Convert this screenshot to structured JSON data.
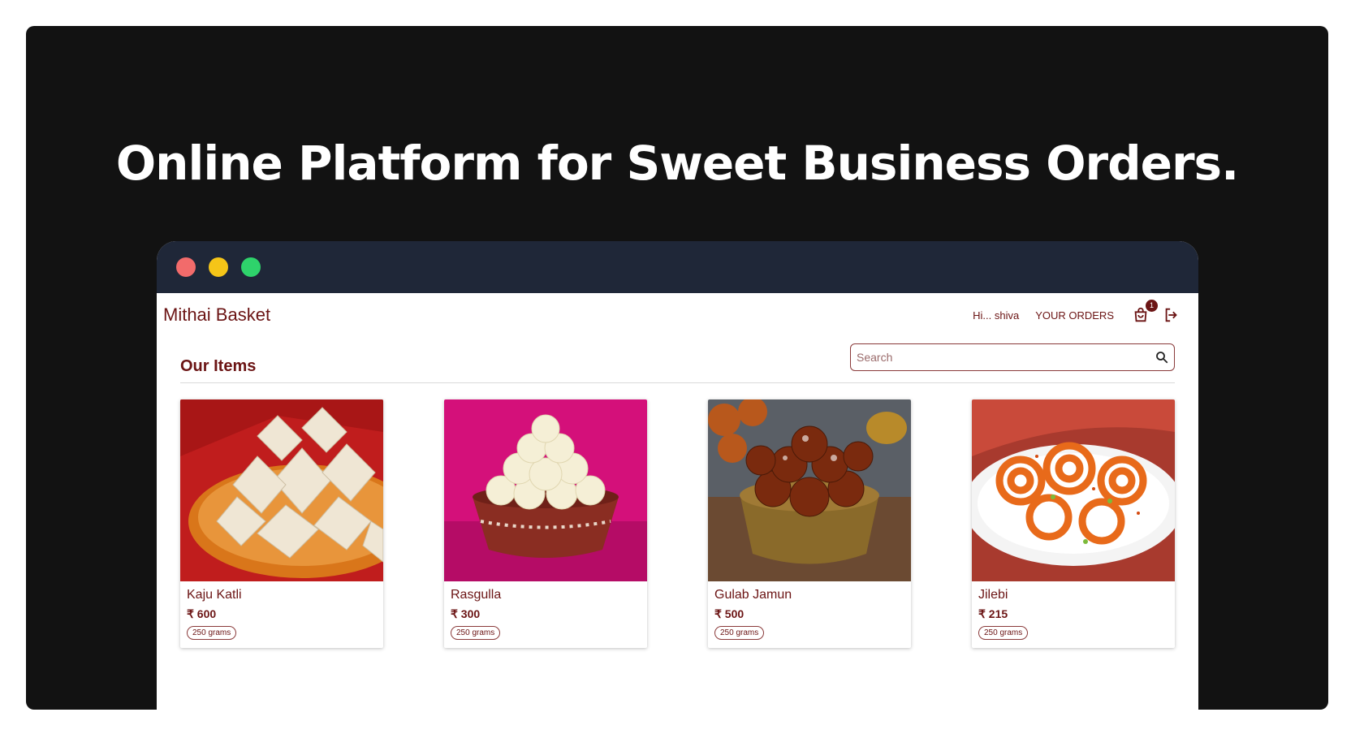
{
  "headline": "Online Platform for Sweet Business Orders.",
  "window_colors": {
    "close": "#f26b6b",
    "minimize": "#f5c518",
    "maximize": "#2ed36b"
  },
  "navbar": {
    "brand": "Mithai Basket",
    "greeting": "Hi... shiva",
    "orders_label": "YOUR ORDERS",
    "cart_count": "1",
    "cart_icon": "shopping-bag-icon",
    "logout_icon": "logout-icon"
  },
  "main": {
    "title": "Our Items",
    "search": {
      "placeholder": "Search",
      "value": "",
      "icon": "search-icon"
    }
  },
  "items": [
    {
      "name": "Kaju Katli",
      "price": "₹ 600",
      "weight": "250 grams"
    },
    {
      "name": "Rasgulla",
      "price": "₹ 300",
      "weight": "250 grams"
    },
    {
      "name": "Gulab Jamun",
      "price": "₹ 500",
      "weight": "250 grams"
    },
    {
      "name": "Jilebi",
      "price": "₹ 215",
      "weight": "250 grams"
    }
  ],
  "colors": {
    "accent": "#6b1414",
    "titlebar": "#1f2738",
    "background": "#121212"
  }
}
